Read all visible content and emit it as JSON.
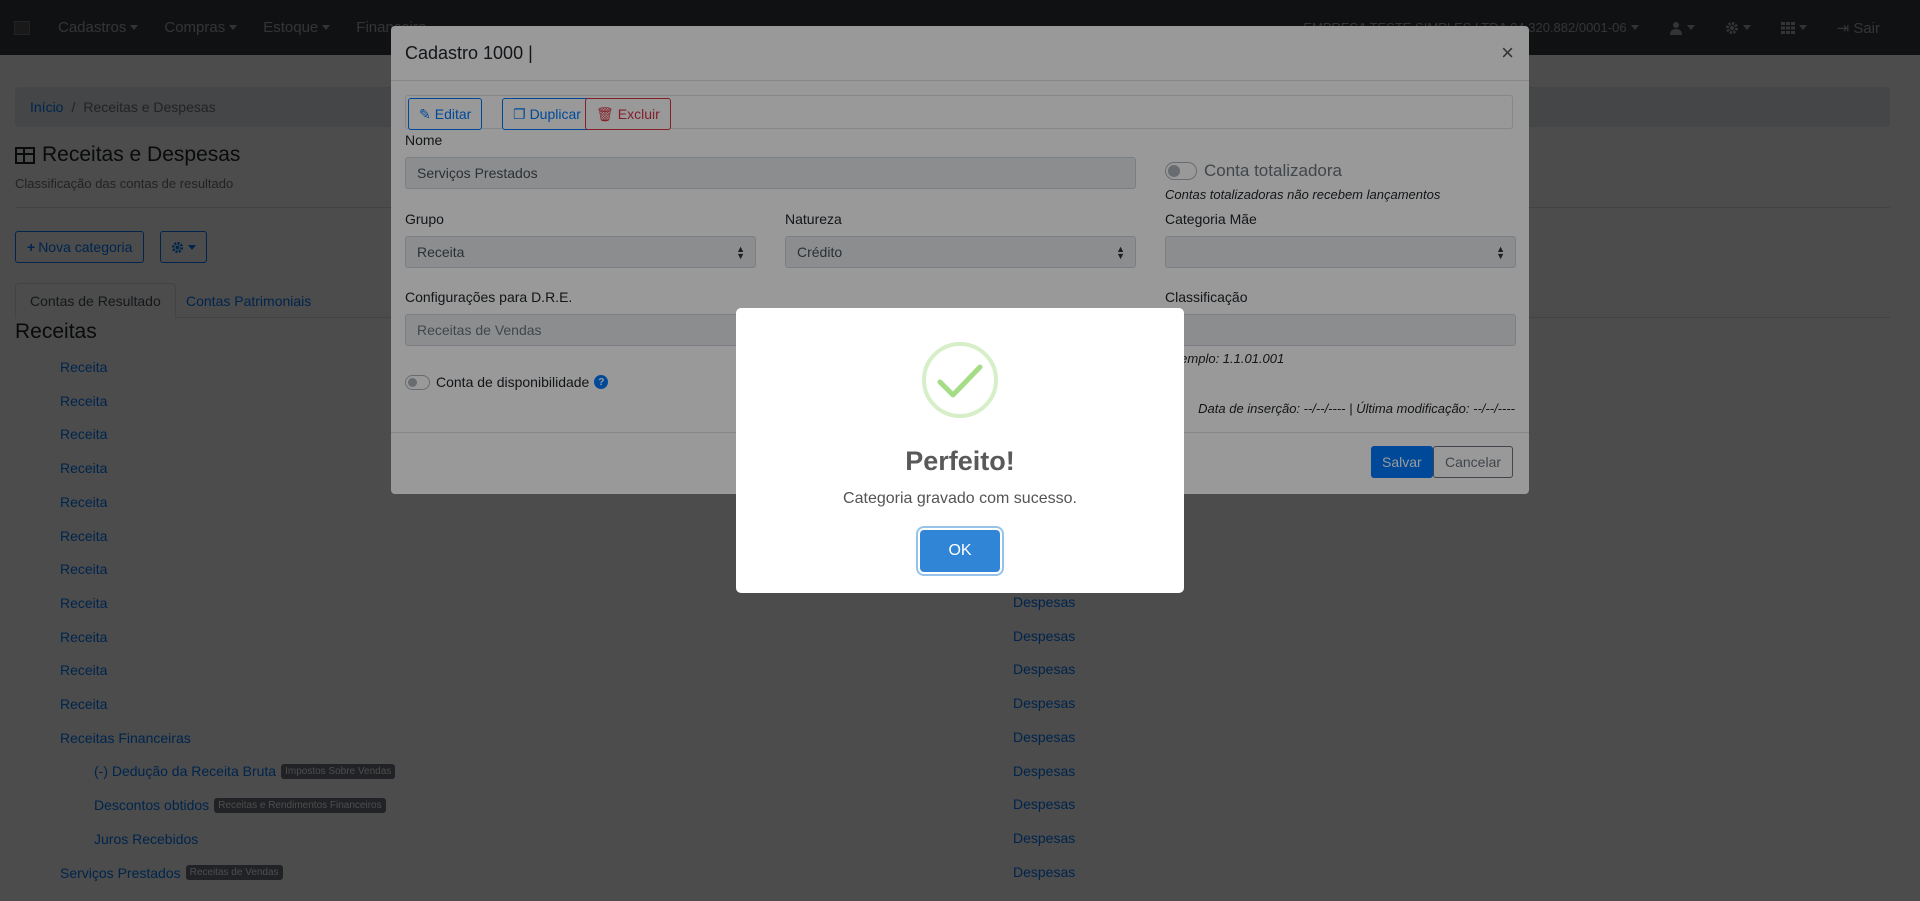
{
  "navbar": {
    "menus": [
      "Cadastros",
      "Compras",
      "Estoque",
      "Financeiro"
    ],
    "company": "EMPRESA TESTE SIMPLES LTDA 04.320.882/0001-06",
    "sair": "Sair",
    "icons": [
      "user-icon",
      "gear-icon",
      "apps-grid-icon",
      "sign-out-icon"
    ]
  },
  "breadcrumb": {
    "home": "Início",
    "separator": "/",
    "current": "Receitas e Despesas"
  },
  "page": {
    "title": "Receitas e Despesas",
    "subtitle": "Classificação das contas de resultado",
    "new_button": "Nova categoria",
    "tabs": [
      "Contas de Resultado",
      "Contas Patrimoniais"
    ],
    "section_title": "Receitas"
  },
  "receitas": [
    {
      "label": "Receita",
      "badge": "",
      "level": 1
    },
    {
      "label": "Receita",
      "badge": "",
      "level": 1
    },
    {
      "label": "Receita",
      "badge": "",
      "level": 1
    },
    {
      "label": "Receita",
      "badge": "",
      "level": 1
    },
    {
      "label": "Receita",
      "badge": "",
      "level": 1
    },
    {
      "label": "Receita",
      "badge": "",
      "level": 1
    },
    {
      "label": "Receita",
      "badge": "",
      "level": 1
    },
    {
      "label": "Receita",
      "badge": "",
      "level": 1
    },
    {
      "label": "Receita",
      "badge": "",
      "level": 1
    },
    {
      "label": "Receita",
      "badge": "",
      "level": 1
    },
    {
      "label": "Receita",
      "badge": "",
      "level": 1
    },
    {
      "label": "Receitas Financeiras",
      "badge": "",
      "level": 1
    },
    {
      "label": "(-) Dedução da Receita Bruta",
      "badge": "Impostos Sobre Vendas",
      "level": 2
    },
    {
      "label": "Descontos obtidos",
      "badge": "Receitas e Rendimentos Financeiros",
      "level": 2
    },
    {
      "label": "Juros Recebidos",
      "badge": "",
      "level": 2
    },
    {
      "label": "Serviços Prestados",
      "badge": "Receitas de Vendas",
      "level": 1
    }
  ],
  "despesas": [
    "Despesas",
    "Despesas",
    "Despesas",
    "Despesas",
    "Despesas",
    "Despesas",
    "Despesas",
    "Despesas",
    "Despesas"
  ],
  "modal": {
    "title": "Cadastro 1000 |",
    "close": "×",
    "edit": "Editar",
    "duplicate": "Duplicar",
    "delete": "Excluir",
    "nome_label": "Nome",
    "nome_value": "Serviços Prestados",
    "totalizadora_label": "Conta totalizadora",
    "totalizadora_hint": "Contas totalizadoras não recebem lançamentos",
    "grupo_label": "Grupo",
    "grupo_value": "Receita",
    "natureza_label": "Natureza",
    "natureza_value": "Crédito",
    "categoria_mae_label": "Categoria Mãe",
    "categoria_mae_value": "",
    "dre_label": "Configurações para D.R.E.",
    "dre_value": "Receitas de Vendas",
    "classificacao_label": "Classificação",
    "classificacao_value": "",
    "classificacao_hint": "Exemplo: 1.1.01.001",
    "dates": "Data de inserção: --/--/---- | Última modificação: --/--/----",
    "disponibilidade_label": "Conta de disponibilidade",
    "save": "Salvar",
    "cancel": "Cancelar"
  },
  "alert": {
    "title": "Perfeito!",
    "text": "Categoria gravado com sucesso.",
    "ok": "OK",
    "icon": "success-check-icon",
    "icon_color": "#a5dc86"
  },
  "colors": {
    "primary": "#007bff",
    "danger": "#dc3545",
    "navbar": "#343a40",
    "ok_button": "#3085d6"
  }
}
